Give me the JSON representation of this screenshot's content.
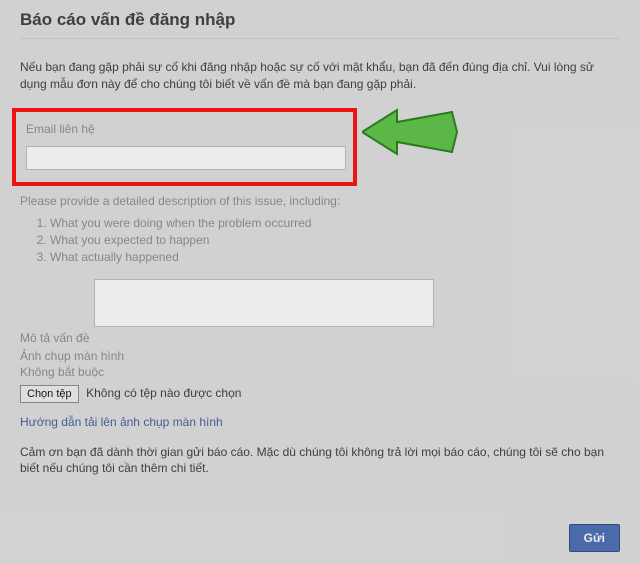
{
  "page": {
    "title": "Báo cáo vấn đề đăng nhập",
    "description": "Nếu bạn đang gặp phải sự cố khi đăng nhập hoặc sự cố với mật khẩu, bạn đã đến đúng địa chỉ. Vui lòng sử dụng mẫu đơn này để cho chúng tôi biết về vấn đề mà bạn đang gặp phải."
  },
  "email": {
    "label": "Email liên hệ"
  },
  "detail": {
    "instruction": "Please provide a detailed description of this issue, including:",
    "items": [
      "What you were doing when the problem occurred",
      "What you expected to happen",
      "What actually happened"
    ]
  },
  "problem": {
    "label": "Mô tả vấn đề"
  },
  "screenshot": {
    "label": "Ảnh chụp màn hình",
    "optional": "Không bắt buộc",
    "choose_button": "Chọn tệp",
    "no_file": "Không có tệp nào được chọn",
    "guide_link": "Hướng dẫn tải lên ảnh chụp màn hình"
  },
  "footer": {
    "text": "Cảm ơn bạn đã dành thời gian gửi báo cáo. Mặc dù chúng tôi không trả lời mọi báo cáo, chúng tôi sẽ cho bạn biết nếu chúng tôi cần thêm chi tiết."
  },
  "submit": {
    "label": "Gửi"
  },
  "colors": {
    "highlight": "#ff0000",
    "arrow": "#3cb043"
  }
}
